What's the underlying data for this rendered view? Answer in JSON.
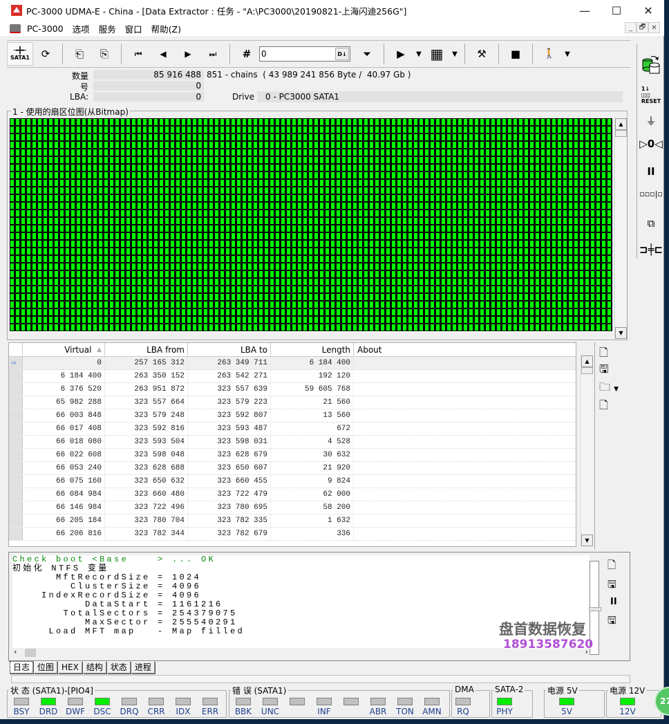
{
  "window": {
    "title": "PC-3000 UDMA-E - China - [Data Extractor : 任务 - \"A:\\PC3000\\20190821-上海闪迪256G\"]",
    "controls": {
      "minimize": "—",
      "maximize": "☐",
      "close": "✕"
    },
    "mdi_controls": {
      "minimize": "_",
      "restore": "🗗",
      "close": "✕"
    }
  },
  "menu": {
    "items": [
      {
        "label": "PC-3000"
      },
      {
        "label": "选项"
      },
      {
        "label": "服务"
      },
      {
        "label": "窗口"
      },
      {
        "label": "帮助(Z)"
      }
    ]
  },
  "toolbar": {
    "sata_label": "SATA1",
    "position_value": "0",
    "position_btn": "D↓",
    "icons": {
      "sata": "╼╋╾",
      "refresh": "⟳",
      "load": "⎗",
      "save": "⎘",
      "first": "⏮",
      "prev": "◀",
      "next": "▶",
      "last": "⏭",
      "goto": "#",
      "filter": "⏷",
      "play": "▶",
      "dropdown": "▼",
      "grid": "▦",
      "tools": "⚒",
      "stop": "■",
      "exit": "🚶"
    }
  },
  "info": {
    "count_label": "数量",
    "count_value": "85 916 488",
    "count_extra": "851 - chains  ( 43 989 241 856 Byte /  40.97 Gb )",
    "number_label": "号",
    "number_value": "0",
    "lba_label": "LBA:",
    "lba_value": "0",
    "drive_label": "Drive",
    "drive_value": "0 - PC3000 SATA1"
  },
  "bitmap": {
    "title": "1 - 使用的扇区位图(从Bitmap)",
    "used_color": "#00ff00",
    "used_fraction": 1.0
  },
  "table": {
    "columns": [
      "Virtual",
      "LBA from",
      "LBA to",
      "Length",
      "About"
    ],
    "sort_indicator": "▲",
    "rows": [
      {
        "virtual": "0",
        "lba_from": "257 165 312",
        "lba_to": "263 349 711",
        "length": "6 184 400",
        "about": "",
        "current": true
      },
      {
        "virtual": "6 184 400",
        "lba_from": "263 350 152",
        "lba_to": "263 542 271",
        "length": "192 120",
        "about": ""
      },
      {
        "virtual": "6 376 520",
        "lba_from": "263 951 872",
        "lba_to": "323 557 639",
        "length": "59 605 768",
        "about": ""
      },
      {
        "virtual": "65 982 288",
        "lba_from": "323 557 664",
        "lba_to": "323 579 223",
        "length": "21 560",
        "about": ""
      },
      {
        "virtual": "66 003 848",
        "lba_from": "323 579 248",
        "lba_to": "323 592 807",
        "length": "13 560",
        "about": ""
      },
      {
        "virtual": "66 017 408",
        "lba_from": "323 592 816",
        "lba_to": "323 593 487",
        "length": "672",
        "about": ""
      },
      {
        "virtual": "66 018 080",
        "lba_from": "323 593 504",
        "lba_to": "323 598 031",
        "length": "4 528",
        "about": ""
      },
      {
        "virtual": "66 022 608",
        "lba_from": "323 598 048",
        "lba_to": "323 628 679",
        "length": "30 632",
        "about": ""
      },
      {
        "virtual": "66 053 240",
        "lba_from": "323 628 688",
        "lba_to": "323 650 607",
        "length": "21 920",
        "about": ""
      },
      {
        "virtual": "66 075 160",
        "lba_from": "323 650 632",
        "lba_to": "323 660 455",
        "length": "9 824",
        "about": ""
      },
      {
        "virtual": "66 084 984",
        "lba_from": "323 660 480",
        "lba_to": "323 722 479",
        "length": "62 000",
        "about": ""
      },
      {
        "virtual": "66 146 984",
        "lba_from": "323 722 496",
        "lba_to": "323 780 695",
        "length": "58 200",
        "about": ""
      },
      {
        "virtual": "66 205 184",
        "lba_from": "323 780 704",
        "lba_to": "323 782 335",
        "length": "1 632",
        "about": ""
      },
      {
        "virtual": "66 206 816",
        "lba_from": "323 782 344",
        "lba_to": "323 782 679",
        "length": "336",
        "about": ""
      }
    ],
    "current_row_icon": "⇨"
  },
  "log": {
    "lines": [
      {
        "text": "Check boot <Base    > ... OK",
        "color": "green"
      },
      {
        "text": "初始化 NTFS 变量",
        "color": "black"
      },
      {
        "text": "      MftRecordSize = 1024",
        "color": "black"
      },
      {
        "text": "        ClusterSize = 4096",
        "color": "black"
      },
      {
        "text": "    IndexRecordSize = 4096",
        "color": "black"
      },
      {
        "text": "          DataStart = 1161216",
        "color": "black"
      },
      {
        "text": "       TotalSectors = 254379075",
        "color": "black"
      },
      {
        "text": "          MaxSector = 255540291",
        "color": "black"
      },
      {
        "text": "     Load MFT map   - Map filled",
        "color": "black"
      }
    ]
  },
  "tabs": [
    {
      "label": "日志",
      "active": true
    },
    {
      "label": "位图"
    },
    {
      "label": "HEX"
    },
    {
      "label": "结构"
    },
    {
      "label": "状态"
    },
    {
      "label": "进程"
    }
  ],
  "status": {
    "state_group": {
      "title": "状 态 (SATA1)-[PIO4]",
      "leds": [
        {
          "label": "BSY",
          "on": false
        },
        {
          "label": "DRD",
          "on": true
        },
        {
          "label": "DWF",
          "on": false
        },
        {
          "label": "DSC",
          "on": true
        },
        {
          "label": "DRQ",
          "on": false
        },
        {
          "label": "CRR",
          "on": false
        },
        {
          "label": "IDX",
          "on": false
        },
        {
          "label": "ERR",
          "on": false
        }
      ]
    },
    "error_group": {
      "title": "错 误 (SATA1)",
      "leds": [
        {
          "label": "BBK",
          "on": false
        },
        {
          "label": "UNC",
          "on": false
        },
        {
          "label": "",
          "on": false
        },
        {
          "label": "INF",
          "on": false
        },
        {
          "label": "",
          "on": false
        },
        {
          "label": "ABR",
          "on": false
        },
        {
          "label": "TON",
          "on": false
        },
        {
          "label": "AMN",
          "on": false
        }
      ]
    },
    "dma_group": {
      "title": "DMA",
      "leds": [
        {
          "label": "RQ",
          "on": false
        }
      ]
    },
    "sata_group": {
      "title": "SATA-2",
      "leds": [
        {
          "label": "PHY",
          "on": true
        }
      ]
    },
    "power5_group": {
      "title": "电源 5V",
      "leds": [
        {
          "label": "5V",
          "on": true
        }
      ]
    },
    "power12_group": {
      "title": "电源 12V",
      "leds": [
        {
          "label": "12V",
          "on": true
        }
      ]
    }
  },
  "watermark": {
    "name": "盘首数据恢复",
    "phone": "18913587620"
  },
  "badge": {
    "text": "27"
  }
}
